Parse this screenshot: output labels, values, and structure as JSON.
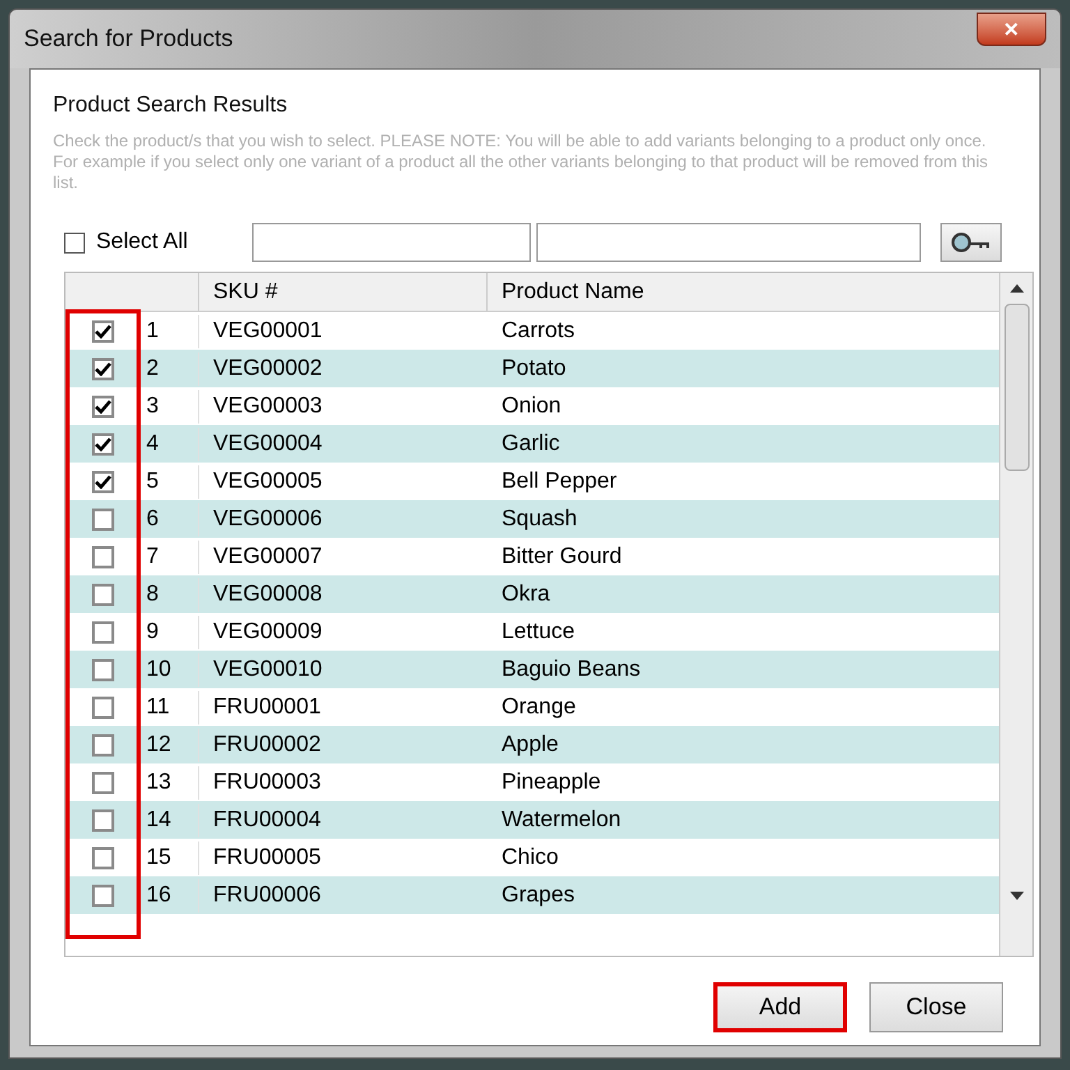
{
  "window": {
    "title": "Search for Products",
    "close": "✕"
  },
  "heading": "Product Search Results",
  "note": "Check the product/s that you wish to select. PLEASE NOTE: You will be able to add variants belonging to a product only once. For example if you select only one variant of a product all the other variants belonging to that product will be removed from this list.",
  "select_all": {
    "label": "Select All",
    "checked": false
  },
  "table": {
    "columns": [
      "SKU #",
      "Product Name"
    ],
    "rows": [
      {
        "num": "1",
        "sku": "VEG00001",
        "name": "Carrots",
        "checked": true
      },
      {
        "num": "2",
        "sku": "VEG00002",
        "name": "Potato",
        "checked": true
      },
      {
        "num": "3",
        "sku": "VEG00003",
        "name": "Onion",
        "checked": true
      },
      {
        "num": "4",
        "sku": "VEG00004",
        "name": "Garlic",
        "checked": true
      },
      {
        "num": "5",
        "sku": "VEG00005",
        "name": "Bell Pepper",
        "checked": true
      },
      {
        "num": "6",
        "sku": "VEG00006",
        "name": "Squash",
        "checked": false
      },
      {
        "num": "7",
        "sku": "VEG00007",
        "name": "Bitter Gourd",
        "checked": false
      },
      {
        "num": "8",
        "sku": "VEG00008",
        "name": "Okra",
        "checked": false
      },
      {
        "num": "9",
        "sku": "VEG00009",
        "name": "Lettuce",
        "checked": false
      },
      {
        "num": "10",
        "sku": "VEG00010",
        "name": "Baguio Beans",
        "checked": false
      },
      {
        "num": "11",
        "sku": "FRU00001",
        "name": "Orange",
        "checked": false
      },
      {
        "num": "12",
        "sku": "FRU00002",
        "name": "Apple",
        "checked": false
      },
      {
        "num": "13",
        "sku": "FRU00003",
        "name": "Pineapple",
        "checked": false
      },
      {
        "num": "14",
        "sku": "FRU00004",
        "name": "Watermelon",
        "checked": false
      },
      {
        "num": "15",
        "sku": "FRU00005",
        "name": "Chico",
        "checked": false
      },
      {
        "num": "16",
        "sku": "FRU00006",
        "name": "Grapes",
        "checked": false
      }
    ]
  },
  "buttons": [
    {
      "label": "Add",
      "highlighted": true
    },
    {
      "label": "Close",
      "highlighted": false
    }
  ]
}
